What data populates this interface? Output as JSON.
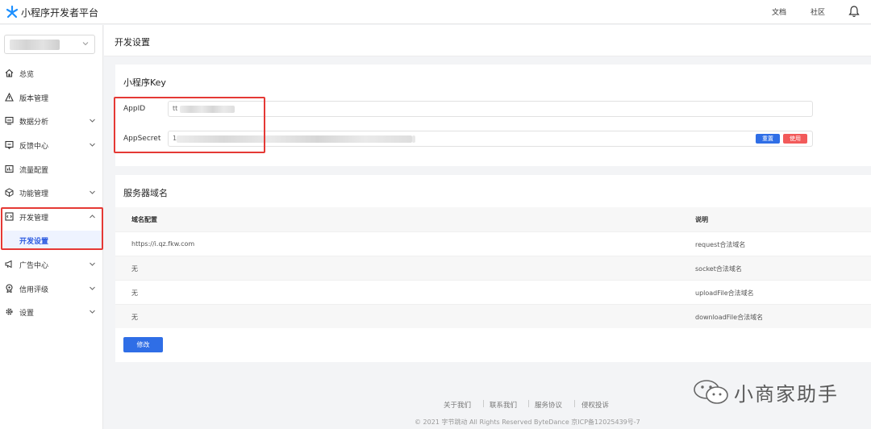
{
  "header": {
    "brand": "小程序开发者平台",
    "nav": [
      "文档",
      "社区"
    ]
  },
  "sidebar": {
    "items": [
      {
        "label": "总览",
        "icon": "home-icon",
        "chevron": false
      },
      {
        "label": "版本管理",
        "icon": "triangle-icon",
        "chevron": false
      },
      {
        "label": "数据分析",
        "icon": "monitor-icon",
        "chevron": true
      },
      {
        "label": "反馈中心",
        "icon": "feedback-icon",
        "chevron": true
      },
      {
        "label": "流量配置",
        "icon": "bar-chart-icon",
        "chevron": false
      },
      {
        "label": "功能管理",
        "icon": "cube-icon",
        "chevron": true
      },
      {
        "label": "开发管理",
        "icon": "code-icon",
        "chevron": true,
        "expanded": true
      },
      {
        "label": "广告中心",
        "icon": "megaphone-icon",
        "chevron": true
      },
      {
        "label": "信用评级",
        "icon": "badge-icon",
        "chevron": true
      },
      {
        "label": "设置",
        "icon": "gear-icon",
        "chevron": true
      }
    ],
    "sub_item": "开发设置"
  },
  "page": {
    "title": "开发设置"
  },
  "key_card": {
    "title": "小程序Key",
    "appid_label": "AppID",
    "appid_prefix": "tt",
    "secret_label": "AppSecret",
    "secret_prefix": "1",
    "reset_label": "重置",
    "use_label": "使用"
  },
  "domain_card": {
    "title": "服务器域名",
    "columns": [
      "域名配置",
      "说明"
    ],
    "rows": [
      {
        "domain": "https://i.qz.fkw.com",
        "desc": "request合法域名"
      },
      {
        "domain": "无",
        "desc": "socket合法域名"
      },
      {
        "domain": "无",
        "desc": "uploadFile合法域名"
      },
      {
        "domain": "无",
        "desc": "downloadFile合法域名"
      }
    ],
    "edit_label": "修改"
  },
  "footer": {
    "links": [
      "关于我们",
      "联系我们",
      "服务协议",
      "侵权投诉"
    ],
    "separator": "|",
    "copyright": "© 2021 字节跳动 All Rights Reserved ByteDance 京ICP备12025439号-7"
  },
  "watermark": {
    "text": "小商家助手"
  },
  "colors": {
    "primary": "#2f6ee6",
    "danger": "#f25a5a",
    "highlight_red": "#e53935",
    "active_text": "#2b5ae0"
  }
}
